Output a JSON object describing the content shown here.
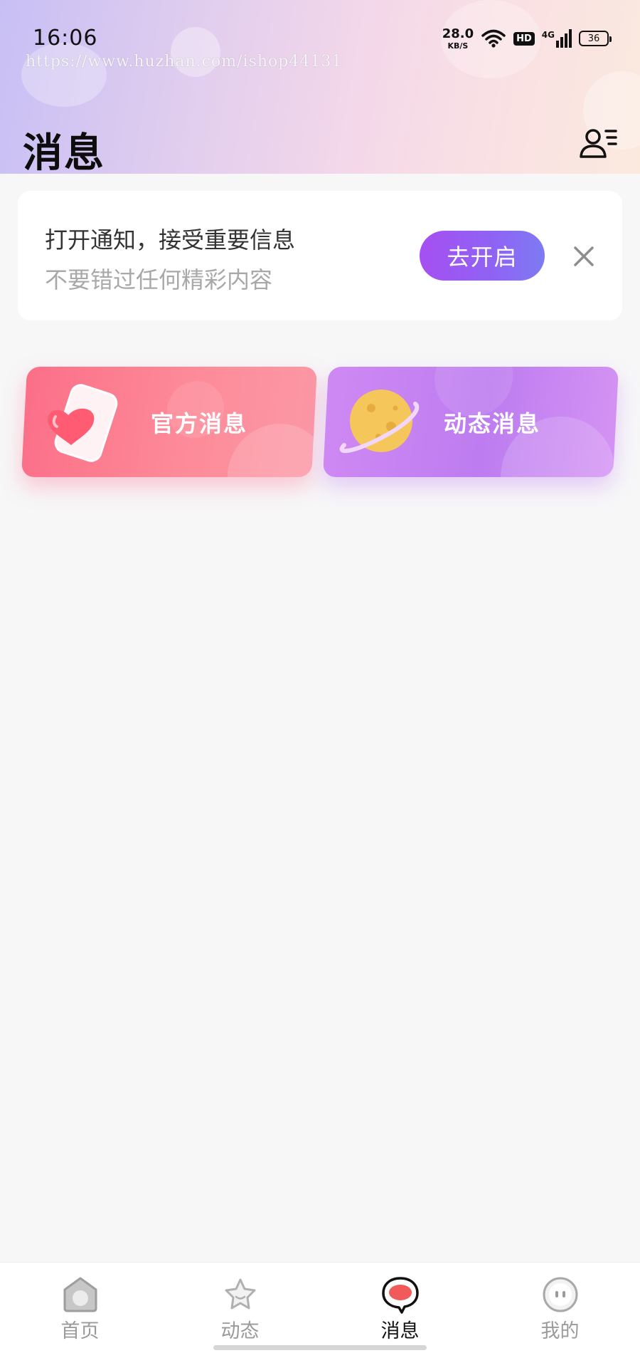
{
  "status_bar": {
    "time": "16:06",
    "net_speed_value": "28.0",
    "net_speed_unit": "KB/S",
    "hd": "HD",
    "network": "4G",
    "battery": "36",
    "icons": [
      "wifi-icon",
      "signal-icon",
      "battery-icon"
    ]
  },
  "watermark": "https://www.huzhan.com/ishop44131",
  "header": {
    "title": "消息",
    "contacts_icon": "contacts-list-icon"
  },
  "notice": {
    "title": "打开通知，接受重要信息",
    "subtitle": "不要错过任何精彩内容",
    "button_label": "去开启",
    "close_icon": "close-icon"
  },
  "categories": [
    {
      "label": "官方消息",
      "icon": "heart-card-icon",
      "color": "#fb6f88"
    },
    {
      "label": "动态消息",
      "icon": "planet-icon",
      "color": "#c883f2"
    }
  ],
  "bottom_nav": {
    "items": [
      {
        "label": "首页",
        "icon": "home-icon",
        "active": false
      },
      {
        "label": "动态",
        "icon": "star-icon",
        "active": false
      },
      {
        "label": "消息",
        "icon": "message-icon",
        "active": true
      },
      {
        "label": "我的",
        "icon": "profile-icon",
        "active": false
      }
    ]
  },
  "colors": {
    "accent": "#9b5cf3",
    "active_nav_icon": "#f05a5a",
    "inactive_nav": "#9a9a9a"
  }
}
